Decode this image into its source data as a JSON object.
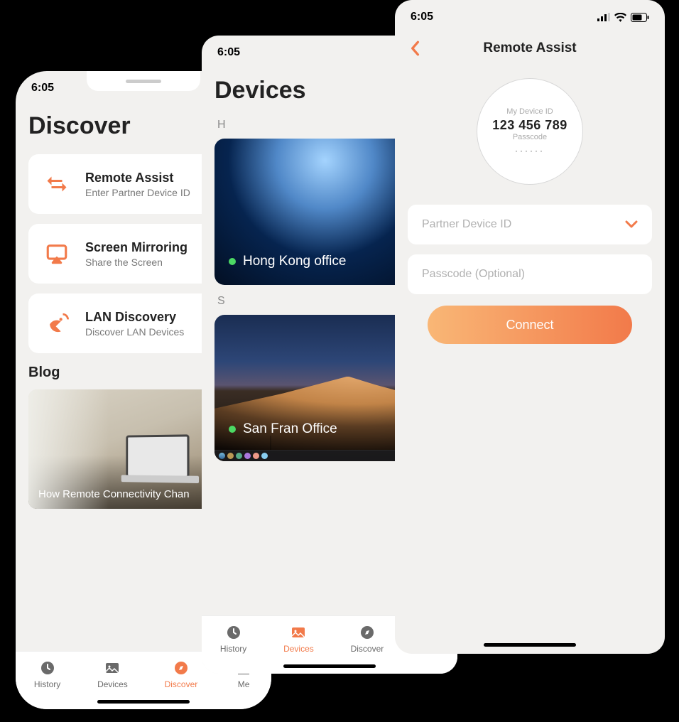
{
  "shared": {
    "time": "6:05",
    "tabs": [
      "History",
      "Devices",
      "Discover",
      "Me"
    ]
  },
  "phone1": {
    "title": "Discover",
    "cards": [
      {
        "title": "Remote Assist",
        "sub": "Enter Partner Device ID"
      },
      {
        "title": "Screen Mirroring",
        "sub": "Share the Screen"
      },
      {
        "title": "LAN Discovery",
        "sub": "Discover LAN Devices"
      }
    ],
    "blog_label": "Blog",
    "blog_caption": "How Remote Connectivity Chan",
    "active_tab": "Discover"
  },
  "phone2": {
    "title": "Devices",
    "groups": [
      {
        "letter": "H",
        "name": "Hong Kong office"
      },
      {
        "letter": "S",
        "name": "San Fran Office"
      }
    ],
    "active_tab": "Devices"
  },
  "phone3": {
    "title": "Remote Assist",
    "my_id_label": "My Device ID",
    "my_id_value": "123 456 789",
    "passcode_label": "Passcode",
    "passcode_dots": "······",
    "partner_placeholder": "Partner Device ID",
    "passcode_placeholder": "Passcode (Optional)",
    "connect_label": "Connect"
  }
}
